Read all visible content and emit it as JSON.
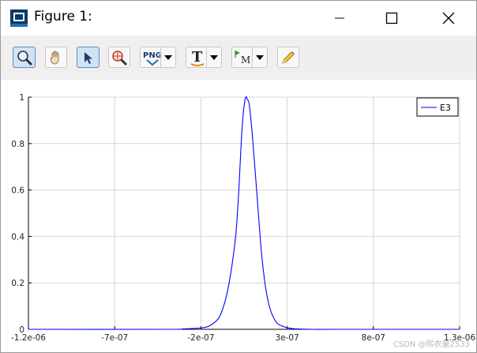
{
  "window": {
    "title": "Figure 1:"
  },
  "toolbar": {
    "buttons": [
      {
        "id": "zoom",
        "icon": "zoom-icon",
        "active": true
      },
      {
        "id": "pan",
        "icon": "hand-icon",
        "active": false
      },
      {
        "id": "select",
        "icon": "arrow-pointer-icon",
        "active": true
      },
      {
        "id": "rotate",
        "icon": "rotate-zoom-icon",
        "active": false
      },
      {
        "id": "save-png",
        "icon": "png-icon",
        "label": "PNG",
        "dropdown": true
      },
      {
        "id": "insert-text",
        "icon": "text-icon",
        "label": "T",
        "dropdown": true
      },
      {
        "id": "marker",
        "icon": "marker-icon",
        "label": "M",
        "dropdown": true
      },
      {
        "id": "edit",
        "icon": "pencil-icon",
        "active": false
      }
    ]
  },
  "chart_data": {
    "type": "line",
    "title": "",
    "xlabel": "",
    "ylabel": "",
    "xlim": [
      -1.2e-06,
      1.3e-06
    ],
    "ylim": [
      0,
      1
    ],
    "x_ticks": [
      -1.2e-06,
      -7e-07,
      -2e-07,
      3e-07,
      8e-07,
      1.3e-06
    ],
    "x_tick_labels": [
      "-1.2e-06",
      "-7e-07",
      "-2e-07",
      "3e-07",
      "8e-07",
      "1.3e-06"
    ],
    "y_ticks": [
      0,
      0.2,
      0.4,
      0.6,
      0.8,
      1
    ],
    "y_tick_labels": [
      "0",
      "0.2",
      "0.4",
      "0.6",
      "0.8",
      "1"
    ],
    "grid": true,
    "legend_position": "top-right",
    "series": [
      {
        "name": "E3",
        "color": "#0000ff",
        "x": [
          -1.2e-06,
          -4e-07,
          -3e-07,
          -2e-07,
          -1.5e-07,
          -1e-07,
          -7.5e-08,
          -5e-08,
          -2.5e-08,
          0,
          1e-08,
          2e-08,
          3e-08,
          4e-08,
          5e-08,
          6e-08,
          7e-08,
          8e-08,
          9e-08,
          1e-07,
          1.25e-07,
          1.5e-07,
          1.75e-07,
          2e-07,
          2.25e-07,
          2.5e-07,
          3e-07,
          3.5e-07,
          4.5e-07,
          6e-07,
          1.3e-06
        ],
        "y": [
          0,
          0,
          0.002,
          0.006,
          0.015,
          0.045,
          0.085,
          0.15,
          0.25,
          0.39,
          0.48,
          0.6,
          0.75,
          0.88,
          0.96,
          1.0,
          0.99,
          0.97,
          0.9,
          0.82,
          0.58,
          0.34,
          0.18,
          0.09,
          0.045,
          0.022,
          0.007,
          0.002,
          0,
          0,
          0
        ]
      }
    ]
  },
  "watermark": "CSDN @熙衣童2533"
}
